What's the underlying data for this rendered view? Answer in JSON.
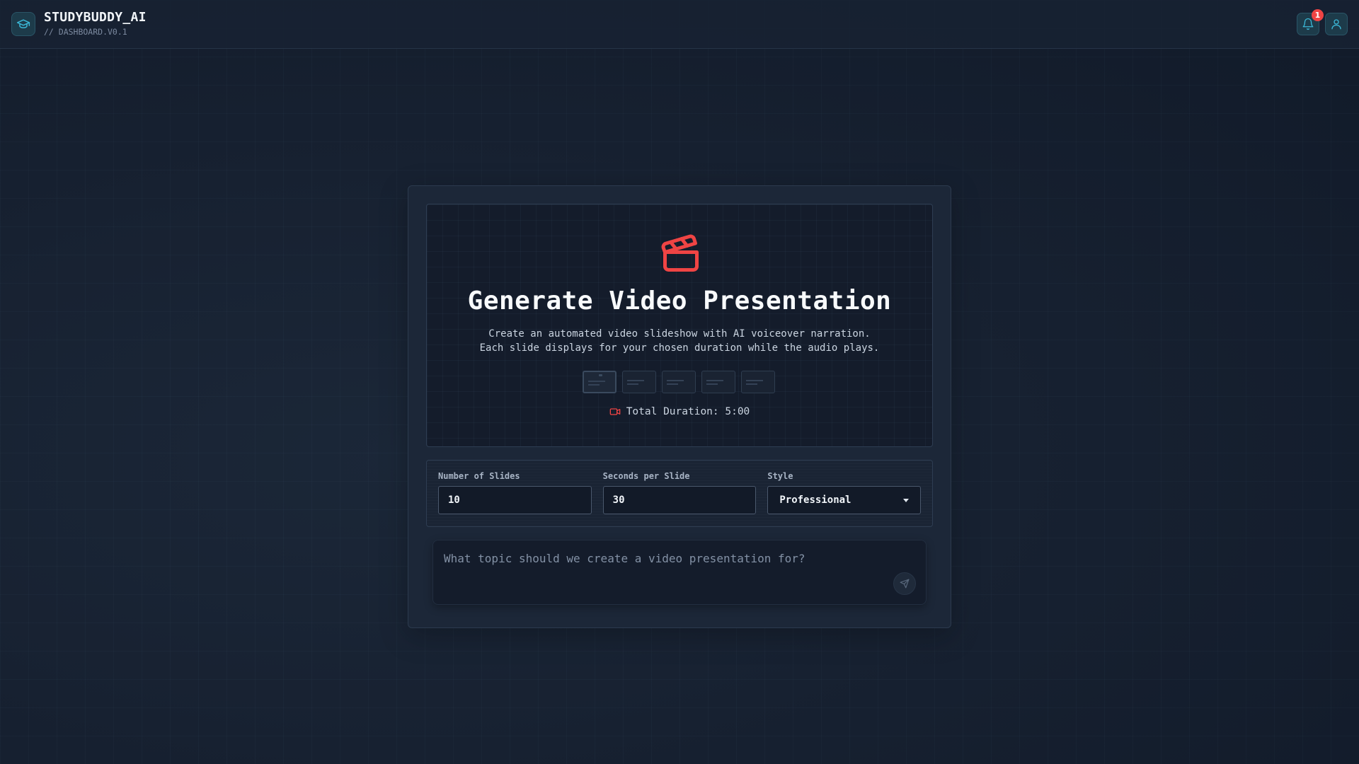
{
  "app": {
    "name": "STUDYBUDDY_AI",
    "subtitle": "// DASHBOARD.V0.1",
    "logo_icon": "graduation-cap-icon"
  },
  "header": {
    "notifications": {
      "icon": "bell-icon",
      "count": "1"
    },
    "profile": {
      "icon": "user-icon"
    }
  },
  "hero": {
    "icon": "clapperboard-icon",
    "title": "Generate Video Presentation",
    "description_line1": "Create an automated video slideshow with AI voiceover narration.",
    "description_line2": "Each slide displays for your chosen duration while the audio plays.",
    "slide_previews": 5,
    "duration_icon": "video-camera-icon",
    "duration_label": "Total Duration: 5:00"
  },
  "settings": {
    "slides": {
      "label": "Number of Slides",
      "value": "10"
    },
    "seconds": {
      "label": "Seconds per Slide",
      "value": "30"
    },
    "style": {
      "label": "Style",
      "value": "Professional"
    }
  },
  "prompt": {
    "placeholder": "What topic should we create a video presentation for?",
    "send_icon": "send-icon"
  },
  "colors": {
    "accent_red": "#ef4444",
    "accent_cyan": "#3bb7d6",
    "background": "#172131"
  }
}
